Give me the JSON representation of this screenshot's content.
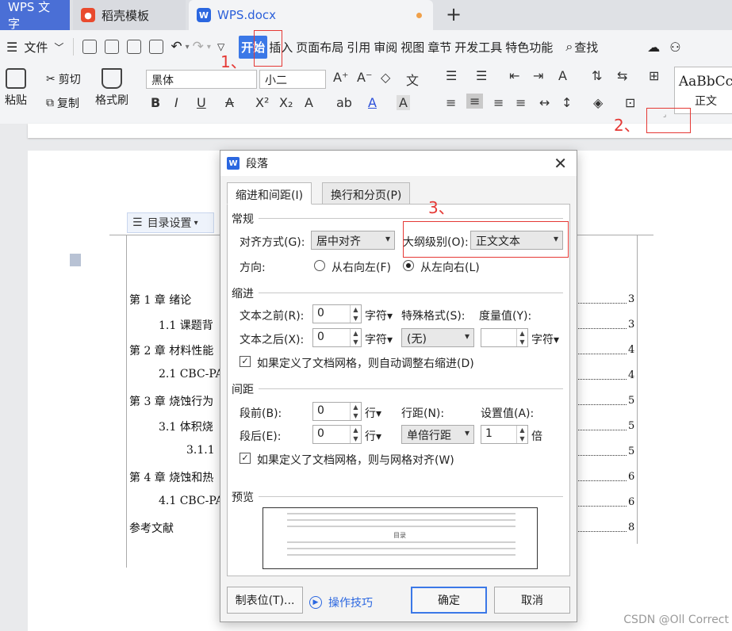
{
  "tabs": {
    "app": "WPS 文字",
    "template": "稻壳模板",
    "document": "WPS.docx",
    "new_tab": "+"
  },
  "menu": {
    "file": "文件",
    "home": "开始",
    "insert": "插入",
    "layout": "页面布局",
    "references": "引用",
    "review": "审阅",
    "view": "视图",
    "section": "章节",
    "developer": "开发工具",
    "special": "特色功能",
    "search": "查找"
  },
  "toolbar": {
    "paste": "粘贴",
    "cut": "剪切",
    "copy": "复制",
    "format_painter": "格式刷",
    "font_name": "黑体",
    "font_size": "小二",
    "style_preview": "AaBbCc",
    "style_name": "正文"
  },
  "annotations": {
    "step1": "1、",
    "step2": "2、",
    "step3": "3、"
  },
  "document": {
    "toc_button": "目录设置",
    "toc": [
      {
        "text": "第 1 章  绪论",
        "page": "3"
      },
      {
        "text": "1.1 课题背",
        "page": "3"
      },
      {
        "text": "第 2 章  材料性能",
        "page": "4"
      },
      {
        "text": "2.1 CBC-PA",
        "page": "4"
      },
      {
        "text": "第 3 章  烧蚀行为",
        "page": "5"
      },
      {
        "text": "3.1 体积烧",
        "page": "5"
      },
      {
        "text": "3.1.1",
        "page": "5"
      },
      {
        "text": "第 4 章  烧蚀和热",
        "page": "6"
      },
      {
        "text": "4.1 CBC-PA",
        "page": "6"
      },
      {
        "text": "参考文献",
        "page": "8"
      }
    ]
  },
  "dialog": {
    "title": "段落",
    "tab_indent": "缩进和间距(I)",
    "tab_breaks": "换行和分页(P)",
    "general": "常规",
    "alignment_label": "对齐方式(G):",
    "alignment_value": "居中对齐",
    "outline_label": "大纲级别(O):",
    "outline_value": "正文文本",
    "direction_label": "方向:",
    "rtl": "从右向左(F)",
    "ltr": "从左向右(L)",
    "indent": "缩进",
    "before_text_label": "文本之前(R):",
    "before_text_value": "0",
    "after_text_label": "文本之后(X):",
    "after_text_value": "0",
    "unit_char": "字符▾",
    "special_label": "特殊格式(S):",
    "special_value": "(无)",
    "measure_label": "度量值(Y):",
    "measure_value": "",
    "grid_indent": "如果定义了文档网格，则自动调整右缩进(D)",
    "spacing": "间距",
    "before_label": "段前(B):",
    "before_value": "0",
    "after_label": "段后(E):",
    "after_value": "0",
    "unit_line": "行▾",
    "line_spacing_label": "行距(N):",
    "line_spacing_value": "单倍行距",
    "set_value_label": "设置值(A):",
    "set_value": "1",
    "unit_times": "倍",
    "grid_align": "如果定义了文档网格，则与网格对齐(W)",
    "preview": "预览",
    "preview_center": "目录",
    "tabs_button": "制表位(T)...",
    "tips_link": "操作技巧",
    "ok": "确定",
    "cancel": "取消"
  },
  "watermark": "CSDN @Oll Correct"
}
